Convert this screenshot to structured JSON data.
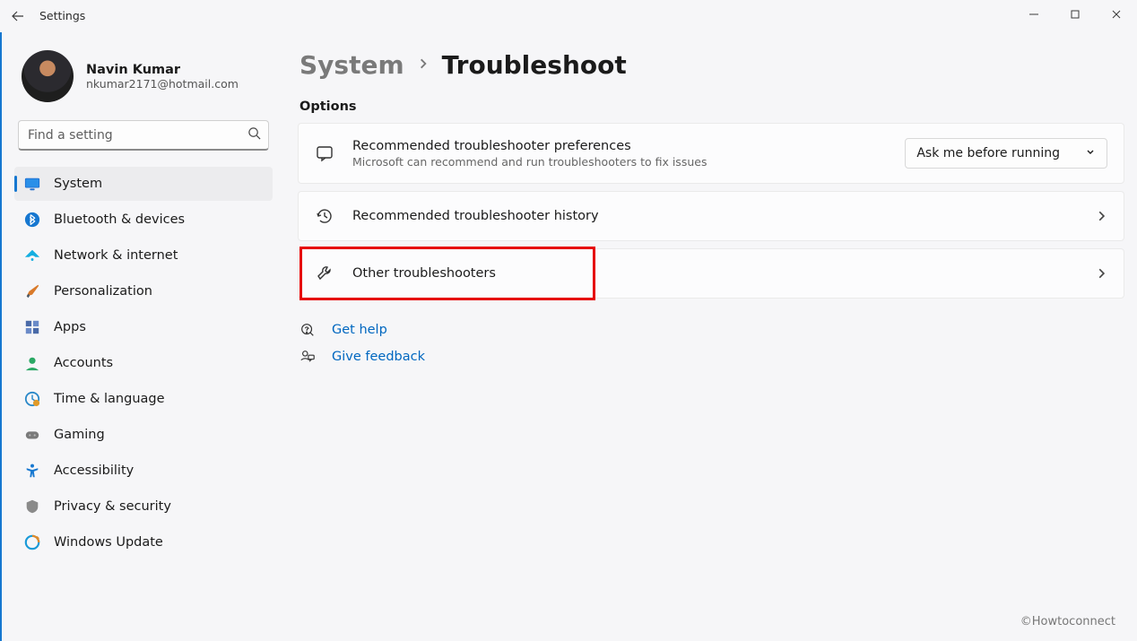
{
  "titlebar": {
    "title": "Settings"
  },
  "profile": {
    "name": "Navin Kumar",
    "email": "nkumar2171@hotmail.com"
  },
  "search": {
    "placeholder": "Find a setting"
  },
  "nav": {
    "items": [
      {
        "label": "System",
        "active": true
      },
      {
        "label": "Bluetooth & devices"
      },
      {
        "label": "Network & internet"
      },
      {
        "label": "Personalization"
      },
      {
        "label": "Apps"
      },
      {
        "label": "Accounts"
      },
      {
        "label": "Time & language"
      },
      {
        "label": "Gaming"
      },
      {
        "label": "Accessibility"
      },
      {
        "label": "Privacy & security"
      },
      {
        "label": "Windows Update"
      }
    ]
  },
  "breadcrumb": {
    "parent": "System",
    "current": "Troubleshoot"
  },
  "sections": {
    "options": "Options"
  },
  "cards": {
    "pref": {
      "title": "Recommended troubleshooter preferences",
      "subtitle": "Microsoft can recommend and run troubleshooters to fix issues",
      "dropdown": "Ask me before running"
    },
    "history": {
      "title": "Recommended troubleshooter history"
    },
    "other": {
      "title": "Other troubleshooters"
    }
  },
  "links": {
    "help": "Get help",
    "feedback": "Give feedback"
  },
  "watermark": "©Howtoconnect"
}
